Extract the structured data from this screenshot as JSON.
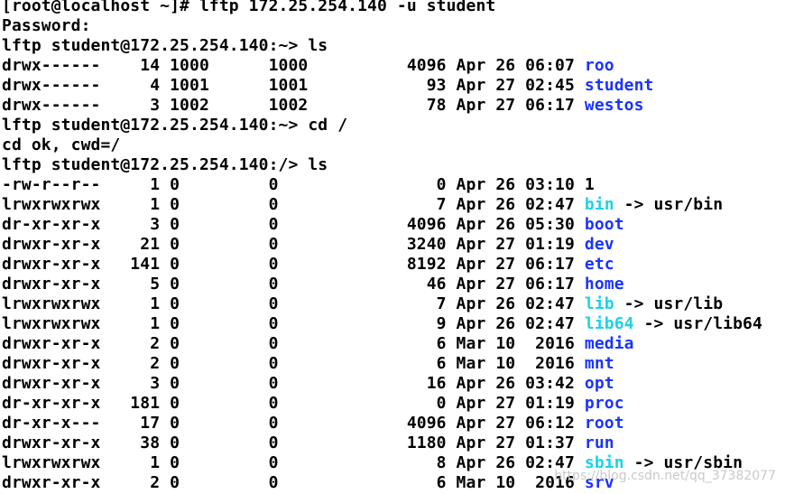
{
  "colors": {
    "background": "#ffffff",
    "text": "#000000",
    "directory": "#1a33ff",
    "symlink": "#1ad3e6",
    "watermark": "#c9c9c9"
  },
  "lines": [
    {
      "text": "[root@localhost ~]# lftp 172.25.254.140 -u student"
    },
    {
      "text": "Password:"
    },
    {
      "text": "lftp student@172.25.254.140:~> ls"
    },
    {
      "perm": "drwx------",
      "links": "14",
      "owner": "1000",
      "group": "1000",
      "size": "4096",
      "date": "Apr 26 06:07",
      "name": "roo",
      "kind": "dir"
    },
    {
      "perm": "drwx------",
      "links": "4",
      "owner": "1001",
      "group": "1001",
      "size": "93",
      "date": "Apr 27 02:45",
      "name": "student",
      "kind": "dir"
    },
    {
      "perm": "drwx------",
      "links": "3",
      "owner": "1002",
      "group": "1002",
      "size": "78",
      "date": "Apr 27 06:17",
      "name": "westos",
      "kind": "dir"
    },
    {
      "text": "lftp student@172.25.254.140:~> cd /"
    },
    {
      "text": "cd ok, cwd=/"
    },
    {
      "text": "lftp student@172.25.254.140:/> ls"
    },
    {
      "perm": "-rw-r--r--",
      "links": "1",
      "owner": "0",
      "group": "0",
      "size": "0",
      "date": "Apr 26 03:10",
      "name": "1",
      "kind": "file"
    },
    {
      "perm": "lrwxrwxrwx",
      "links": "1",
      "owner": "0",
      "group": "0",
      "size": "7",
      "date": "Apr 26 02:47",
      "name": "bin",
      "kind": "link",
      "target": "usr/bin"
    },
    {
      "perm": "dr-xr-xr-x",
      "links": "3",
      "owner": "0",
      "group": "0",
      "size": "4096",
      "date": "Apr 26 05:30",
      "name": "boot",
      "kind": "dir"
    },
    {
      "perm": "drwxr-xr-x",
      "links": "21",
      "owner": "0",
      "group": "0",
      "size": "3240",
      "date": "Apr 27 01:19",
      "name": "dev",
      "kind": "dir"
    },
    {
      "perm": "drwxr-xr-x",
      "links": "141",
      "owner": "0",
      "group": "0",
      "size": "8192",
      "date": "Apr 27 06:17",
      "name": "etc",
      "kind": "dir"
    },
    {
      "perm": "drwxr-xr-x",
      "links": "5",
      "owner": "0",
      "group": "0",
      "size": "46",
      "date": "Apr 27 06:17",
      "name": "home",
      "kind": "dir"
    },
    {
      "perm": "lrwxrwxrwx",
      "links": "1",
      "owner": "0",
      "group": "0",
      "size": "7",
      "date": "Apr 26 02:47",
      "name": "lib",
      "kind": "link",
      "target": "usr/lib"
    },
    {
      "perm": "lrwxrwxrwx",
      "links": "1",
      "owner": "0",
      "group": "0",
      "size": "9",
      "date": "Apr 26 02:47",
      "name": "lib64",
      "kind": "link",
      "target": "usr/lib64"
    },
    {
      "perm": "drwxr-xr-x",
      "links": "2",
      "owner": "0",
      "group": "0",
      "size": "6",
      "date": "Mar 10  2016",
      "name": "media",
      "kind": "dir"
    },
    {
      "perm": "drwxr-xr-x",
      "links": "2",
      "owner": "0",
      "group": "0",
      "size": "6",
      "date": "Mar 10  2016",
      "name": "mnt",
      "kind": "dir"
    },
    {
      "perm": "drwxr-xr-x",
      "links": "3",
      "owner": "0",
      "group": "0",
      "size": "16",
      "date": "Apr 26 03:42",
      "name": "opt",
      "kind": "dir"
    },
    {
      "perm": "dr-xr-xr-x",
      "links": "181",
      "owner": "0",
      "group": "0",
      "size": "0",
      "date": "Apr 27 01:19",
      "name": "proc",
      "kind": "dir"
    },
    {
      "perm": "dr-xr-x---",
      "links": "17",
      "owner": "0",
      "group": "0",
      "size": "4096",
      "date": "Apr 27 06:12",
      "name": "root",
      "kind": "dir"
    },
    {
      "perm": "drwxr-xr-x",
      "links": "38",
      "owner": "0",
      "group": "0",
      "size": "1180",
      "date": "Apr 27 01:37",
      "name": "run",
      "kind": "dir"
    },
    {
      "perm": "lrwxrwxrwx",
      "links": "1",
      "owner": "0",
      "group": "0",
      "size": "8",
      "date": "Apr 26 02:47",
      "name": "sbin",
      "kind": "link",
      "target": "usr/sbin"
    },
    {
      "perm": "drwxr-xr-x",
      "links": "2",
      "owner": "0",
      "group": "0",
      "size": "6",
      "date": "Mar 10  2016",
      "name": "srv",
      "kind": "dir"
    }
  ],
  "watermark": "https://blog.csdn.net/qq_37382077"
}
